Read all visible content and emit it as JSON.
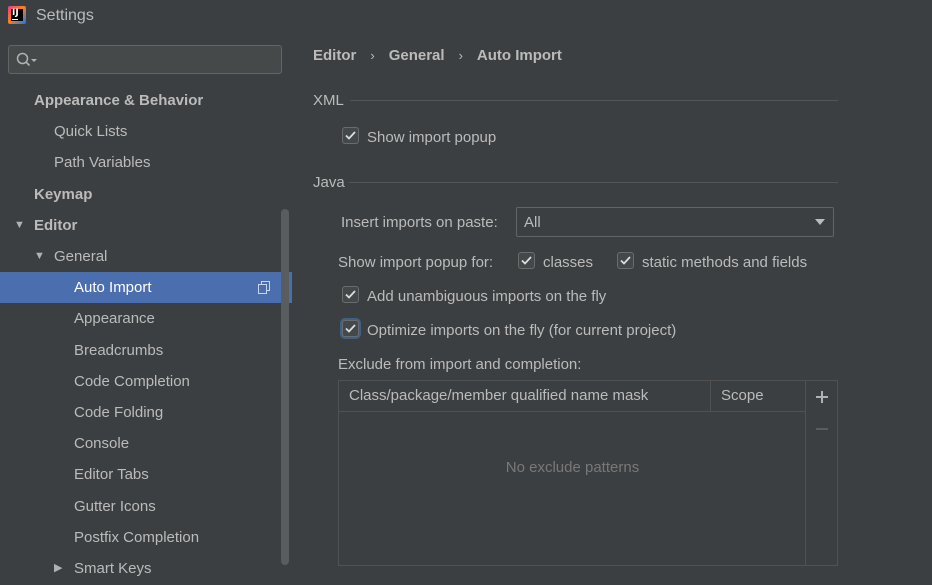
{
  "window": {
    "title": "Settings"
  },
  "search": {
    "placeholder": ""
  },
  "sidebar": {
    "items": [
      {
        "label": "Appearance & Behavior",
        "level": 0,
        "bold": true,
        "arrow": "",
        "selected": false
      },
      {
        "label": "Quick Lists",
        "level": 1,
        "bold": false,
        "arrow": "",
        "selected": false
      },
      {
        "label": "Path Variables",
        "level": 1,
        "bold": false,
        "arrow": "",
        "selected": false
      },
      {
        "label": "Keymap",
        "level": 0,
        "bold": true,
        "arrow": "",
        "selected": false
      },
      {
        "label": "Editor",
        "level": 0,
        "bold": true,
        "arrow": "expanded",
        "selected": false
      },
      {
        "label": "General",
        "level": 1,
        "bold": false,
        "arrow": "expanded",
        "selected": false
      },
      {
        "label": "Auto Import",
        "level": 2,
        "bold": false,
        "arrow": "",
        "selected": true
      },
      {
        "label": "Appearance",
        "level": 2,
        "bold": false,
        "arrow": "",
        "selected": false
      },
      {
        "label": "Breadcrumbs",
        "level": 2,
        "bold": false,
        "arrow": "",
        "selected": false
      },
      {
        "label": "Code Completion",
        "level": 2,
        "bold": false,
        "arrow": "",
        "selected": false
      },
      {
        "label": "Code Folding",
        "level": 2,
        "bold": false,
        "arrow": "",
        "selected": false
      },
      {
        "label": "Console",
        "level": 2,
        "bold": false,
        "arrow": "",
        "selected": false
      },
      {
        "label": "Editor Tabs",
        "level": 2,
        "bold": false,
        "arrow": "",
        "selected": false
      },
      {
        "label": "Gutter Icons",
        "level": 2,
        "bold": false,
        "arrow": "",
        "selected": false
      },
      {
        "label": "Postfix Completion",
        "level": 2,
        "bold": false,
        "arrow": "",
        "selected": false
      },
      {
        "label": "Smart Keys",
        "level": 2,
        "bold": false,
        "arrow": "collapsed",
        "selected": false
      }
    ]
  },
  "breadcrumb": [
    "Editor",
    "General",
    "Auto Import"
  ],
  "xml": {
    "section_title": "XML",
    "show_import_popup": {
      "label": "Show import popup",
      "checked": true
    }
  },
  "java": {
    "section_title": "Java",
    "insert_imports_label": "Insert imports on paste:",
    "insert_imports_value": "All",
    "show_popup_for_label": "Show import popup for:",
    "classes": {
      "label": "classes",
      "checked": true
    },
    "static_methods": {
      "label": "static methods and fields",
      "checked": true
    },
    "add_unambiguous": {
      "label": "Add unambiguous imports on the fly",
      "checked": true
    },
    "optimize_imports": {
      "label": "Optimize imports on the fly (for current project)",
      "checked": true
    },
    "exclude_label": "Exclude from import and completion:",
    "table": {
      "columns": [
        "Class/package/member qualified name mask",
        "Scope"
      ],
      "empty_text": "No exclude patterns"
    }
  }
}
